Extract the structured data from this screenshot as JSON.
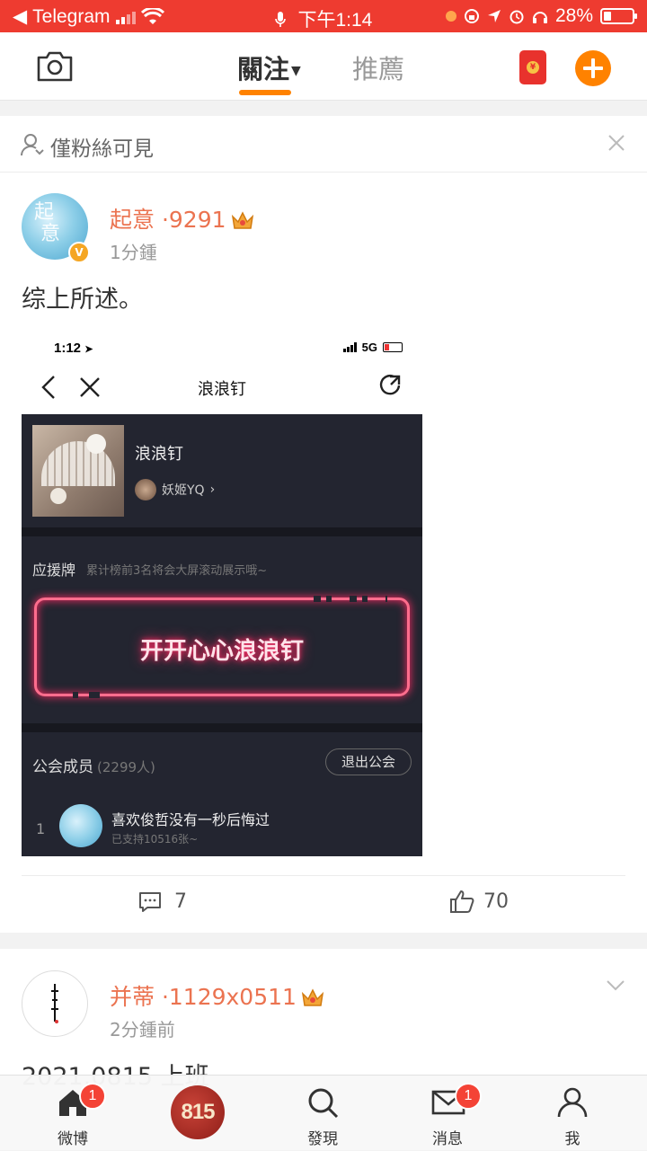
{
  "statusbar": {
    "back_app": "Telegram",
    "time": "下午1:14",
    "battery": "28%",
    "battery_level": 0.28
  },
  "header": {
    "tab_follow": "關注",
    "tab_recommend": "推薦",
    "add_icon": "plus-icon",
    "camera_icon": "camera-icon"
  },
  "post1": {
    "visibility": "僅粉絲可見",
    "username": "起意 ·9291",
    "time": "1分鍾",
    "text": "综上所述。",
    "comments": "7",
    "likes": "70",
    "embedded": {
      "status_time": "1:12",
      "network": "5G",
      "nav_title": "浪浪钉",
      "song_title": "浪浪钉",
      "artist": "妖姬YQ",
      "support_label": "应援牌",
      "support_sub": "累计榜前3名将会大屏滚动展示哦~",
      "neon_text": "开开心心浪浪钉",
      "guild_label": "公会成员",
      "guild_count": "(2299人)",
      "quit_button": "退出公会",
      "member_rank": "1",
      "member_name": "喜欢俊哲没有一秒后悔过",
      "member_sub": "已支持10516张~"
    }
  },
  "post2": {
    "username": "并蒂 ·1129x0511",
    "time": "2分鍾前",
    "text": "2021.0815 上班"
  },
  "bottomnav": {
    "home": "微博",
    "home_badge": "1",
    "center": "815",
    "discover": "發現",
    "messages": "消息",
    "messages_badge": "1",
    "me": "我"
  },
  "colors": {
    "accent": "#ff8200",
    "username": "#eb7350",
    "statusbar": "#ee3b30",
    "neon": "#ff2b64"
  }
}
